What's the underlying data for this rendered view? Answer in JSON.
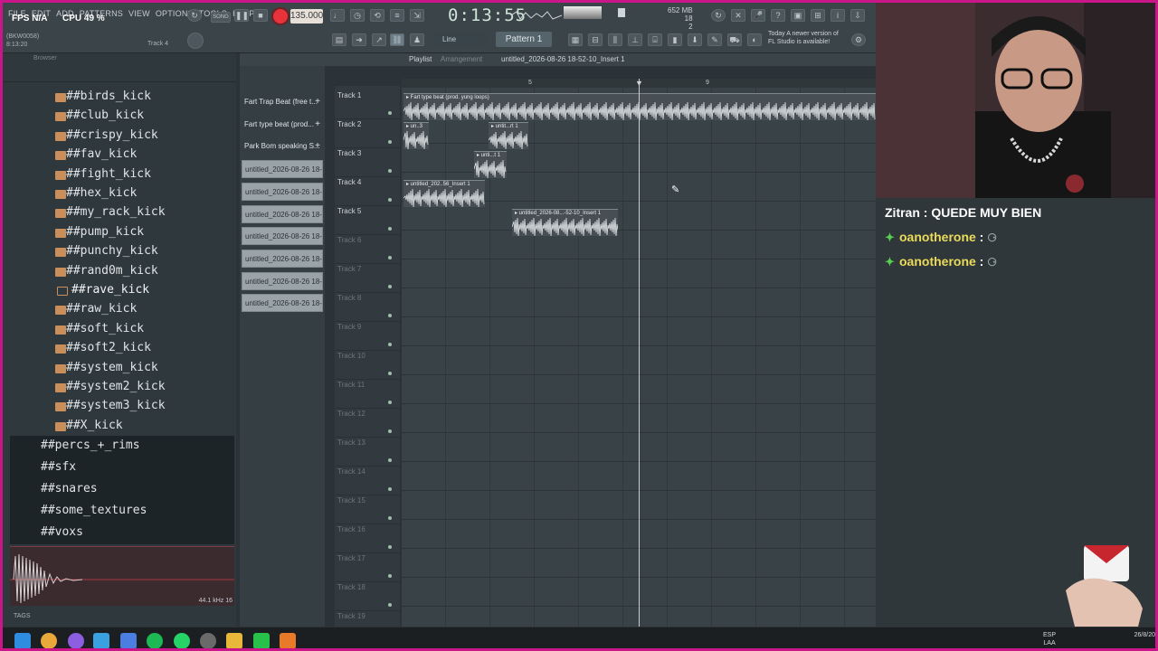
{
  "menu": [
    "FILE",
    "EDIT",
    "ADD",
    "PATTERNS",
    "VIEW",
    "OPTIONS",
    "TOOLS",
    "HELP"
  ],
  "hud": {
    "fps_label": "FPS",
    "fps_value": "N/A",
    "cpu_label": "CPU",
    "cpu_value": "49 %"
  },
  "transport": {
    "mode": "SONG",
    "tempo": "135.000",
    "time": "0:13:55"
  },
  "memory": {
    "value": "652 MB",
    "top_num": "18",
    "bottom_num": "2"
  },
  "toolbar": {
    "snap": "Line",
    "pattern": "Pattern 1"
  },
  "news": {
    "line1": "Today  A newer version of",
    "line2": "FL Studio is available!"
  },
  "small_left": {
    "line1": "(BKW0058)",
    "line2": "8:13:20"
  },
  "track_indicator": "Track 4",
  "browser": {
    "header": "Browser",
    "kicks": [
      "##birds_kick",
      "##club_kick",
      "##crispy_kick",
      "##fav_kick",
      "##fight_kick",
      "##hex_kick",
      "##my_rack_kick",
      "##pump_kick",
      "##punchy_kick",
      "##rand0m_kick",
      "##rave_kick",
      "##raw_kick",
      "##soft_kick",
      "##soft2_kick",
      "##system_kick",
      "##system2_kick",
      "##system3_kick",
      "##X_kick"
    ],
    "selected_kick_index": 10,
    "folders": [
      "##percs_+_rims",
      "##sfx",
      "##snares",
      "##some_textures",
      "##voxs"
    ],
    "sample_rate": "44.1 kHz 16",
    "tags_label": "TAGS"
  },
  "playlist": {
    "title": "Playlist",
    "arrangement": "Arrangement",
    "name": "untitled_2026-08-26 18-52-10_Insert 1",
    "ruler": [
      "5",
      "9"
    ],
    "patterns": [
      {
        "label": "Fart Trap Beat (free t...",
        "kind": "pattern"
      },
      {
        "label": "Fart type beat (prod...",
        "kind": "pattern"
      },
      {
        "label": "Park Bom speaking S...",
        "kind": "pattern"
      },
      {
        "label": "untitled_2026-08-26 18-...",
        "kind": "clip"
      },
      {
        "label": "untitled_2026-08-26 18-...",
        "kind": "clip"
      },
      {
        "label": "untitled_2026-08-26 18-...",
        "kind": "clip"
      },
      {
        "label": "untitled_2026-08-26 18-...",
        "kind": "clip"
      },
      {
        "label": "untitled_2026-08-26 18-...",
        "kind": "clip"
      },
      {
        "label": "untitled_2026-08-26 18-...",
        "kind": "clip"
      },
      {
        "label": "untitled_2026-08-26 18-...",
        "kind": "clip"
      }
    ],
    "tracks": [
      "Track 1",
      "Track 2",
      "Track 3",
      "Track 4",
      "Track 5",
      "Track 6",
      "Track 7",
      "Track 8",
      "Track 9",
      "Track 10",
      "Track 11",
      "Track 12",
      "Track 13",
      "Track 14",
      "Track 15",
      "Track 16",
      "Track 17",
      "Track 18",
      "Track 19"
    ],
    "active_tracks": 5,
    "clips": [
      {
        "label": "Fart type beat (prod. yung loops)",
        "track": 1
      },
      {
        "label": "un..3",
        "track": 2
      },
      {
        "label": "untit...rt 1",
        "track": 2
      },
      {
        "label": "unti...t 1",
        "track": 3
      },
      {
        "label": "untitled_202..56_Insert 1",
        "track": 4
      },
      {
        "label": "untitled_2026-08...-52-10_Insert 1",
        "track": 5
      }
    ]
  },
  "chat": [
    {
      "user": "Zitran",
      "message": "QUEDE MUY BIEN",
      "badge": false,
      "color": "white"
    },
    {
      "user": "oanotherone",
      "message": "",
      "badge": true,
      "color": "yellow"
    },
    {
      "user": "oanotherone",
      "message": "",
      "badge": true,
      "color": "yellow"
    }
  ],
  "tray": {
    "lang1": "ESP",
    "lang2": "LAA",
    "date": "26/8/20"
  },
  "colors": {
    "frame": "#c9178a",
    "record": "#e8333b",
    "chat_user": "#eadb5a",
    "badge": "#55d050"
  }
}
